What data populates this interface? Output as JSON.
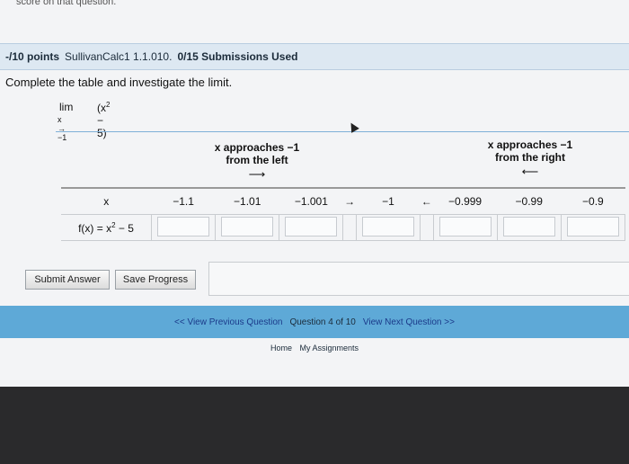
{
  "top_strip": "score on that question.",
  "header": {
    "points": "-/10 points",
    "question_id": "SullivanCalc1 1.1.010.",
    "submissions": "0/15 Submissions Used"
  },
  "prompt": "Complete the table and investigate the limit.",
  "limit": {
    "lim": "lim",
    "subscript": "x → −1",
    "expression_base": "(x",
    "exponent": "2",
    "expression_rest": " − 5)"
  },
  "approach_left": {
    "line1": "x approaches −1",
    "line2": "from the left",
    "arrow": "⟶"
  },
  "approach_right": {
    "line1": "x approaches −1",
    "line2": "from the right",
    "arrow": "⟵"
  },
  "table": {
    "x_label": "x",
    "x_values": [
      "−1.1",
      "−1.01",
      "−1.001",
      "→",
      "−1",
      "←",
      "−0.999",
      "−0.99",
      "−0.9"
    ],
    "fx_label_base": "f(x) = x",
    "fx_label_exp": "2",
    "fx_label_rest": " − 5"
  },
  "buttons": {
    "submit": "Submit Answer",
    "save": "Save Progress"
  },
  "nav": {
    "prev": "<< View Previous Question",
    "position": "Question 4 of 10",
    "next": "View Next Question >>"
  },
  "footer": {
    "home": "Home",
    "assignments": "My Assignments"
  },
  "colors": {
    "header_bg": "#dde8f2",
    "nav_bg": "#5ea9d7",
    "link": "#1b3a8a"
  }
}
